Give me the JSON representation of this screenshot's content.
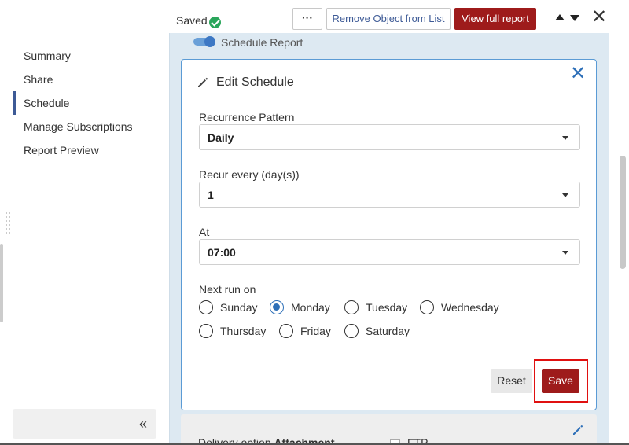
{
  "header": {
    "saved_label": "Saved",
    "more_label": "···",
    "remove_label": "Remove Object from List",
    "view_report_label": "View full report",
    "close_glyph": "✕"
  },
  "sidebar": {
    "items": [
      {
        "label": "Summary"
      },
      {
        "label": "Share"
      },
      {
        "label": "Schedule"
      },
      {
        "label": "Manage Subscriptions"
      },
      {
        "label": "Report Preview"
      }
    ],
    "active_item": "Schedule",
    "collapse_glyph": "«"
  },
  "schedule_report_label": "Schedule Report",
  "edit_schedule": {
    "title": "Edit Schedule",
    "close_glyph": "✕",
    "recurrence": {
      "label": "Recurrence Pattern",
      "value": "Daily"
    },
    "recur_every": {
      "label": "Recur every (day(s))",
      "value": "1"
    },
    "at": {
      "label": "At",
      "value": "07:00"
    },
    "next_run": {
      "label": "Next run on",
      "days": [
        "Sunday",
        "Monday",
        "Tuesday",
        "Wednesday",
        "Thursday",
        "Friday",
        "Saturday"
      ],
      "selected": "Monday"
    },
    "reset_label": "Reset",
    "save_label": "Save"
  },
  "delivery": {
    "label": "Delivery option",
    "value": "Attachment",
    "ftp_label": "FTP"
  },
  "colors": {
    "accent": "#9e1b1b",
    "primary_blue": "#2d6fb8",
    "panel_bg": "#dde9f2",
    "highlight_outline": "#e01010"
  }
}
